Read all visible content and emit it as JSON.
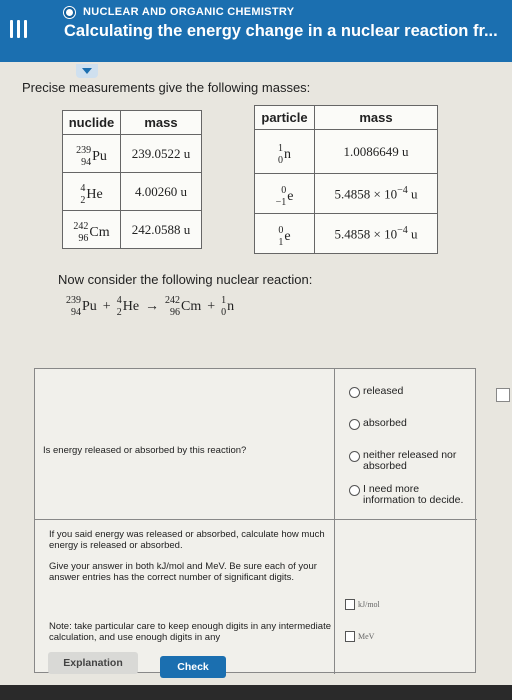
{
  "header": {
    "topic": "NUCLEAR AND ORGANIC CHEMISTRY",
    "title": "Calculating the energy change in a nuclear reaction fr..."
  },
  "intro": "Precise measurements give the following masses:",
  "nuclide_table": {
    "headers": [
      "nuclide",
      "mass"
    ],
    "rows": [
      {
        "sup": "239",
        "sub": "94",
        "sym": "Pu",
        "mass": "239.0522 u"
      },
      {
        "sup": "4",
        "sub": "2",
        "sym": "He",
        "mass": "4.00260 u"
      },
      {
        "sup": "242",
        "sub": "96",
        "sym": "Cm",
        "mass": "242.0588 u"
      }
    ]
  },
  "particle_table": {
    "headers": [
      "particle",
      "mass"
    ],
    "rows": [
      {
        "sup": "1",
        "sub": "0",
        "sym": "n",
        "mass": "1.0086649 u"
      },
      {
        "sup": "0",
        "sub": "−1",
        "sym": "e",
        "mass_base": "5.4858 × 10",
        "mass_exp": "−4",
        "mass_unit": "u"
      },
      {
        "sup": "0",
        "sub": "1",
        "sym": "e",
        "mass_base": "5.4858 × 10",
        "mass_exp": "−4",
        "mass_unit": "u"
      }
    ]
  },
  "consider": "Now consider the following nuclear reaction:",
  "reaction": {
    "r1": {
      "sup": "239",
      "sub": "94",
      "sym": "Pu"
    },
    "r2": {
      "sup": "4",
      "sub": "2",
      "sym": "He"
    },
    "p1": {
      "sup": "242",
      "sub": "96",
      "sym": "Cm"
    },
    "p2": {
      "sup": "1",
      "sub": "0",
      "sym": "n"
    },
    "plus": "+",
    "arrow": "→"
  },
  "question1": "Is energy released or absorbed by this reaction?",
  "options": [
    "released",
    "absorbed",
    "neither released nor absorbed",
    "I need more information to decide."
  ],
  "question2": "If you said energy was released or absorbed, calculate how much energy is released or absorbed.",
  "question3": "Give your answer in both kJ/mol and MeV. Be sure each of your answer entries has the correct number of significant digits.",
  "question4": "Note: take particular care to keep enough digits in any intermediate calculation, and use enough digits in any",
  "units": [
    "kJ/mol",
    "MeV"
  ],
  "buttons": {
    "explanation": "Explanation",
    "check": "Check"
  }
}
